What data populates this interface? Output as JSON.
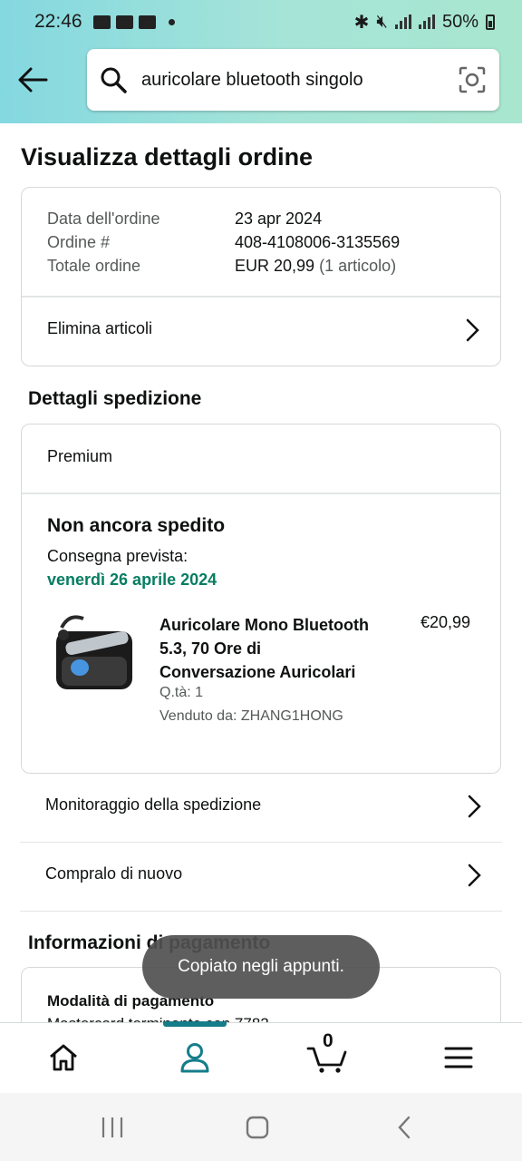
{
  "status_bar": {
    "time": "22:46",
    "battery": "50%"
  },
  "header": {
    "search_query": "auricolare bluetooth singolo"
  },
  "page": {
    "title": "Visualizza dettagli ordine"
  },
  "order_summary": {
    "date_label": "Data dell'ordine",
    "date_value": "23 apr 2024",
    "order_label": "Ordine #",
    "order_value": "408-4108006-3135569",
    "total_label": "Totale ordine",
    "total_value": "EUR 20,99",
    "total_items": "(1 articolo)",
    "delete_items": "Elimina articoli"
  },
  "shipping": {
    "section_title": "Dettagli spedizione",
    "service": "Premium",
    "status": "Non ancora spedito",
    "delivery_label": "Consegna prevista:",
    "delivery_date": "venerdì 26 aprile 2024",
    "product": {
      "title": "Auricolare Mono Bluetooth 5.3, 70 Ore di Conversazione Auricolari",
      "price": "€20,99",
      "qty": "Q.tà: 1",
      "seller": "Venduto da: ZHANG1HONG"
    }
  },
  "actions": {
    "track": "Monitoraggio della spedizione",
    "buy_again": "Compralo di nuovo"
  },
  "payment": {
    "section_title": "Informazioni di pagamento",
    "method_label": "Modalità di pagamento",
    "method_value": "Mastercard terminante con 7782"
  },
  "toast": "Copiato negli appunti.",
  "bottom_nav": {
    "cart_count": "0"
  },
  "colors": {
    "accent": "#157d8a",
    "delivery_green": "#067d62"
  }
}
